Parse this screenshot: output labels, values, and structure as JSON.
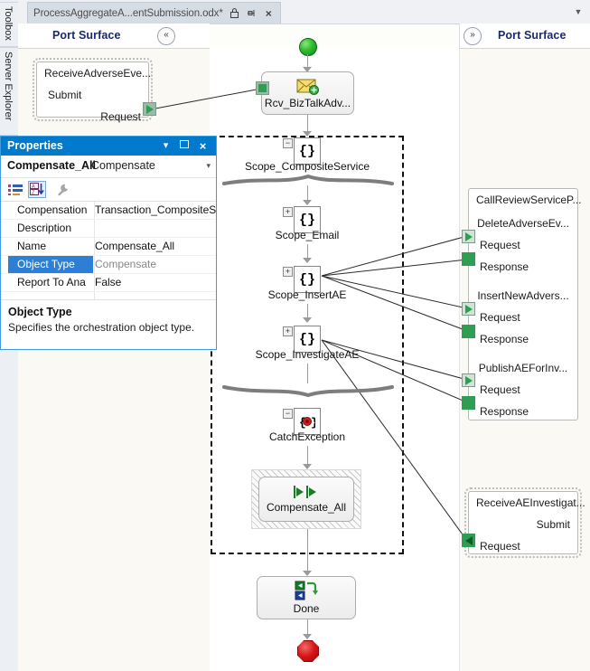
{
  "dock": {
    "toolbox": "Toolbox",
    "server_explorer": "Server Explorer"
  },
  "tabstrip": {
    "document_title": "ProcessAggregateA...entSubmission.odx*",
    "pin_icon": "pin-icon",
    "lock_icon": "lock-icon",
    "close_icon": "×",
    "overflow_chevron": "▼"
  },
  "left_surface": {
    "header": "Port Surface",
    "collapse_icon": "«",
    "port": {
      "title": "ReceiveAdverseEve...",
      "operation": "Submit",
      "message": "Request"
    }
  },
  "right_surface": {
    "header": "Port Surface",
    "expand_icon": "»",
    "ports": [
      {
        "title": "CallReviewServiceP...",
        "operations": [
          {
            "name": "DeleteAdverseEv...",
            "request": "Request",
            "response": "Response"
          },
          {
            "name": "InsertNewAdvers...",
            "request": "Request",
            "response": "Response"
          },
          {
            "name": "PublishAEForInv...",
            "request": "Request",
            "response": "Response"
          }
        ]
      },
      {
        "title": "ReceiveAEInvestigat...",
        "operation": "Submit",
        "message": "Request"
      }
    ]
  },
  "orchestration": {
    "start": "start-shape",
    "receive": {
      "label": "Rcv_BizTalkAdv...",
      "icon": "envelope-receive-icon"
    },
    "scopes": [
      {
        "label": "Scope_CompositeService",
        "toggle": "–",
        "glyph": "{}"
      },
      {
        "label": "Scope_Email",
        "toggle": "+",
        "glyph": "{}"
      },
      {
        "label": "Scope_InsertAE",
        "toggle": "+",
        "glyph": "{}"
      },
      {
        "label": "Scope_InvestigateAE",
        "toggle": "+",
        "glyph": "{}"
      }
    ],
    "catch": {
      "label": "CatchException",
      "toggle": "–",
      "glyph": "{◉}"
    },
    "compensate": {
      "label": "Compensate_All",
      "icon": "compensate-arrows-icon"
    },
    "done": {
      "label": "Done",
      "icon": "loop-send-receive-icon"
    },
    "end": "stop-shape"
  },
  "properties": {
    "title": "Properties",
    "dropdown_icon": "▾",
    "maximize_icon": "❐",
    "close_icon": "×",
    "object_name": "Compensate_All",
    "object_type_label": "Compensate",
    "object_dropdown_icon": "▾",
    "toolbar": {
      "categorized_icon": "categorized-icon",
      "alphabetical_icon": "alphabetical-sort-icon",
      "properties_icon": "wrench-icon"
    },
    "rows": [
      {
        "key": "Compensation",
        "value": "Transaction_CompositeSe",
        "selected": false
      },
      {
        "key": "Description",
        "value": "",
        "selected": false
      },
      {
        "key": "Name",
        "value": "Compensate_All",
        "selected": false
      },
      {
        "key": "Object Type",
        "value": "Compensate",
        "selected": true
      },
      {
        "key": "Report To Ana",
        "value": "False",
        "selected": false
      }
    ],
    "description_title": "Object Type",
    "description_text": "Specifies the orchestration object type."
  },
  "colors": {
    "accent": "#007acc",
    "selection": "#2c7fd4",
    "header_text": "#1b2a6b",
    "connector_green": "#2e9e52",
    "start_green": "#2fbb2f",
    "stop_red": "#d71515"
  }
}
